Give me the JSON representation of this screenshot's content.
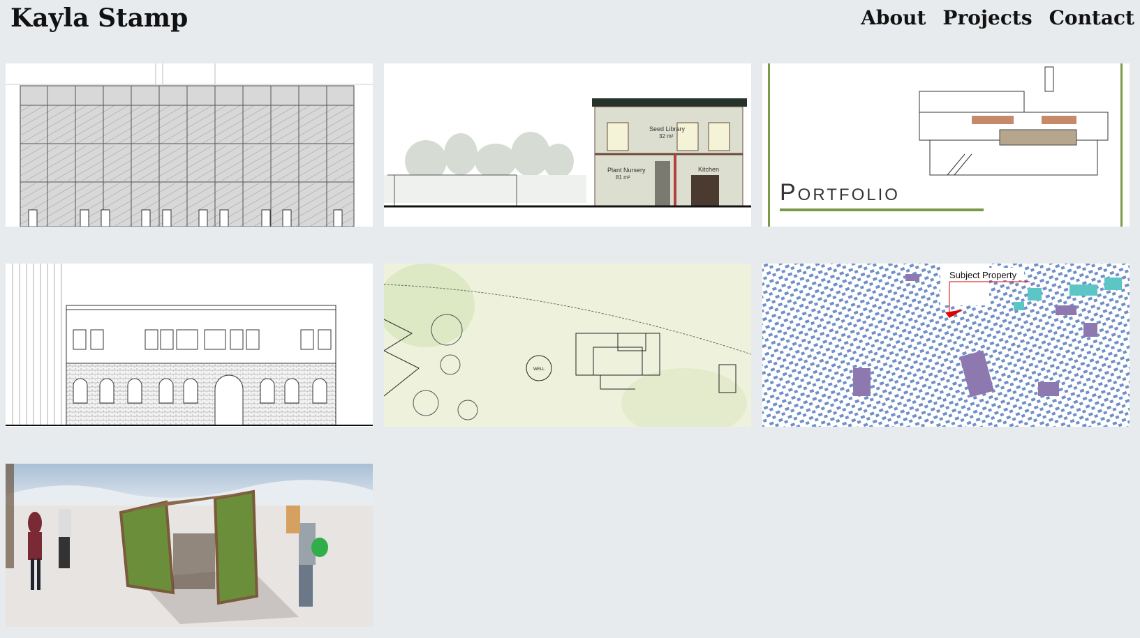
{
  "header": {
    "site_title": "Kayla Stamp",
    "nav": [
      "About",
      "Projects",
      "Contact"
    ]
  },
  "projects": [
    {
      "name": "elevation-hatched"
    },
    {
      "name": "section-seed-library",
      "labels": {
        "seed": "Seed Library",
        "seed_area": "32 m²",
        "nursery": "Plant Nursery",
        "nursery_area": "81 m²",
        "kitchen": "Kitchen"
      }
    },
    {
      "name": "portfolio-cover",
      "title": "Portfolio"
    },
    {
      "name": "elevation-brick"
    },
    {
      "name": "site-plan",
      "labels": {
        "well": "WELL"
      }
    },
    {
      "name": "context-map",
      "subject": "Subject Property"
    },
    {
      "name": "winter-render"
    }
  ],
  "colors": {
    "background": "#e8ebee",
    "portfolio_green": "#7a9a4a",
    "map_blue": "#6f90c8",
    "map_purple": "#8e78b0",
    "map_teal": "#5cc6c6",
    "subject_red": "#e00000"
  }
}
